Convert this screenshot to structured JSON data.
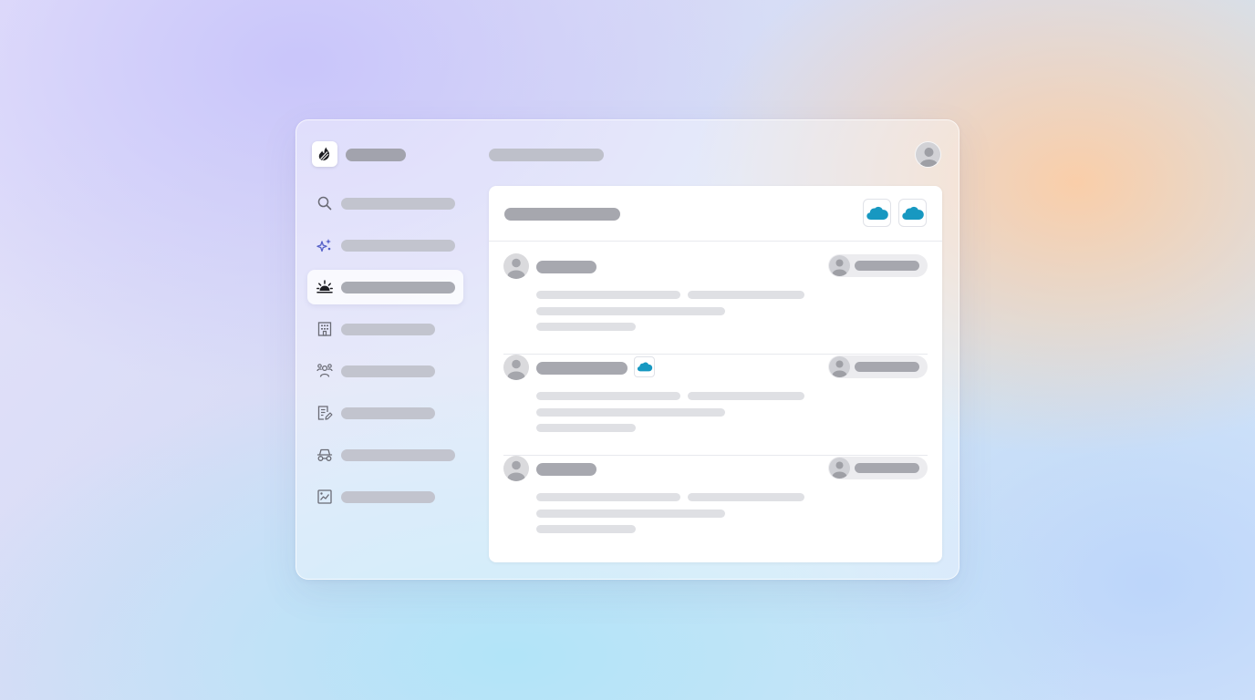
{
  "app": {
    "logo_icon": "flame-logo-icon"
  },
  "header": {
    "profile_icon": "user-avatar-icon"
  },
  "sidebar": {
    "items": [
      {
        "icon": "search-icon",
        "active": false
      },
      {
        "icon": "sparkles-icon",
        "active": false
      },
      {
        "icon": "sunrise-icon",
        "active": true
      },
      {
        "icon": "building-icon",
        "active": false
      },
      {
        "icon": "people-icon",
        "active": false
      },
      {
        "icon": "document-edit-icon",
        "active": false
      },
      {
        "icon": "car-icon",
        "active": false
      },
      {
        "icon": "chart-icon",
        "active": false
      }
    ]
  },
  "panel": {
    "integrations": [
      "salesforce-cloud-icon",
      "salesforce-cloud-icon"
    ],
    "rows": [
      {
        "avatar": "user-avatar-icon",
        "integration_badge": null,
        "assignee_avatar": "user-avatar-icon"
      },
      {
        "avatar": "user-avatar-icon",
        "integration_badge": "salesforce-cloud-icon",
        "assignee_avatar": "user-avatar-icon"
      },
      {
        "avatar": "user-avatar-icon",
        "integration_badge": null,
        "assignee_avatar": "user-avatar-icon"
      }
    ]
  },
  "colors": {
    "accent": "#5560c8",
    "salesforce": "#1798c1",
    "placeholder_dark": "#a6a7ae",
    "placeholder_light": "#dfe0e4"
  }
}
